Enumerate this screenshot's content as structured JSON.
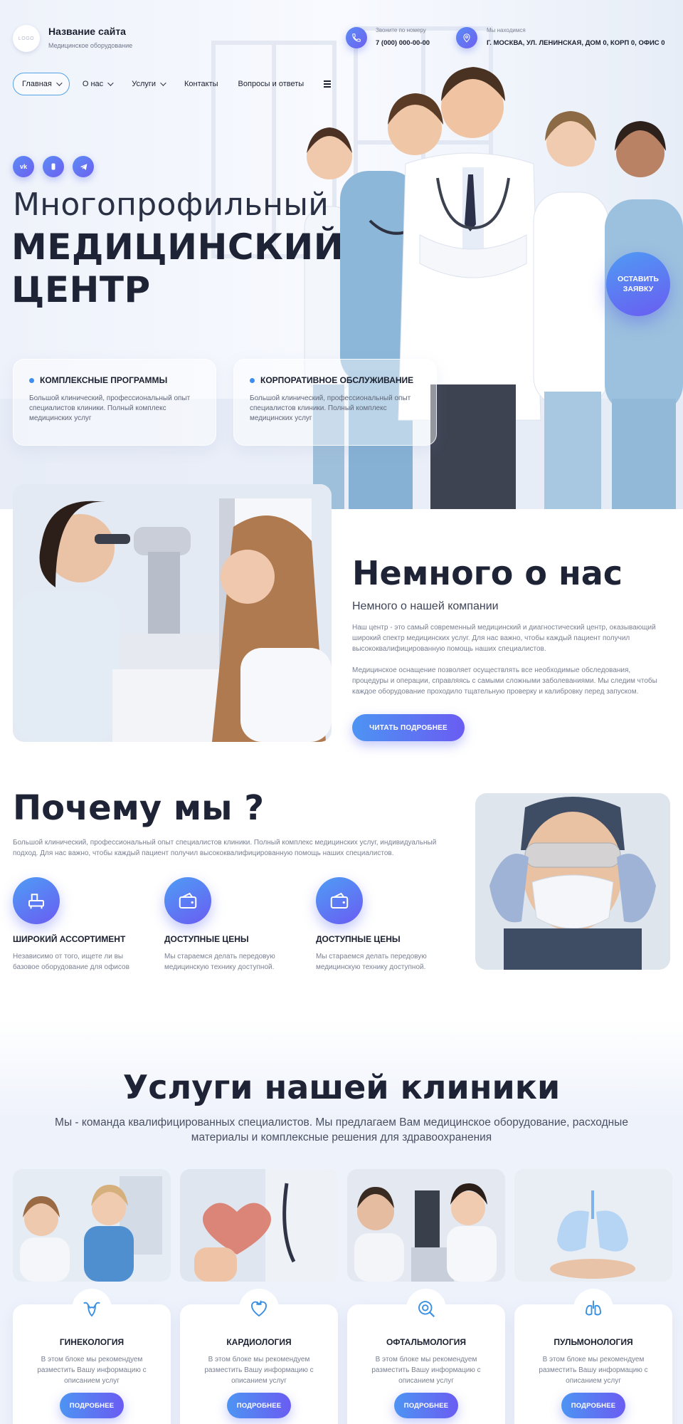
{
  "header": {
    "logo_text": "LOGO",
    "site_title": "Название сайта",
    "site_subtitle": "Медицинское оборудование",
    "phone_label": "Звоните по номеру",
    "phone_value": "7 (000) 000-00-00",
    "address_label": "Мы находимся",
    "address_value": "Г. МОСКВА, УЛ. ЛЕНИНСКАЯ, ДОМ 0, КОРП 0, ОФИС 0"
  },
  "nav": {
    "items": [
      {
        "label": "Главная",
        "has_dropdown": true,
        "active": true
      },
      {
        "label": "О нас",
        "has_dropdown": true
      },
      {
        "label": "Услуги",
        "has_dropdown": true
      },
      {
        "label": "Контакты",
        "has_dropdown": false
      },
      {
        "label": "Вопросы и ответы",
        "has_dropdown": false
      }
    ],
    "menu_icon": "hamburger-icon"
  },
  "social": [
    {
      "icon": "vk-icon",
      "text": "vk"
    },
    {
      "icon": "viber-icon",
      "text": ""
    },
    {
      "icon": "telegram-icon",
      "text": ""
    }
  ],
  "hero": {
    "line1": "Многопрофильный",
    "line2": "МЕДИЦИНСКИЙ",
    "line3": "ЦЕНТР",
    "cta": "ОСТАВИТЬ ЗАЯВКУ",
    "cards": [
      {
        "title": "КОМПЛЕКСНЫЕ ПРОГРАММЫ",
        "text": "Большой клинический, профессиональный опыт специалистов клиники. Полный комплекс медицинских услуг"
      },
      {
        "title": "КОРПОРАТИВНОЕ ОБСЛУЖИВАНИЕ",
        "text": "Большой клинический, профессиональный опыт специалистов клиники. Полный комплекс медицинских услуг"
      }
    ]
  },
  "about": {
    "title": "Немного о нас",
    "subtitle": "Немного о нашей компании",
    "p1": "Наш центр - это самый современный медицинский и диагностический центр, оказывающий широкий спектр медицинских услуг. Для нас важно, чтобы каждый пациент получил высококвалифицированную помощь наших специалистов.",
    "p2": "Медицинское оснащение позволяет осуществлять все необходимые обследования, процедуры и операции, справляясь с самыми сложными заболеваниями. Мы следим чтобы каждое оборудование проходило тщательную проверку и калибровку перед запуском.",
    "button": "ЧИТАТЬ ПОДРОБНЕЕ"
  },
  "why": {
    "title": "Почему мы ?",
    "text": "Большой клинический, профессиональный опыт специалистов клиники. Полный комплекс медицинских услуг, индивидуальный подход. Для нас важно, чтобы каждый пациент получил высококвалифицированную помощь наших специалистов.",
    "features": [
      {
        "icon": "equipment-icon",
        "title": "ШИРОКИЙ АССОРТИМЕНТ",
        "text": "Независимо от того, ищете ли вы базовое оборудование для офисов"
      },
      {
        "icon": "wallet-icon",
        "title": "ДОСТУПНЫЕ ЦЕНЫ",
        "text": "Мы стараемся делать передовую медицинскую технику доступной."
      },
      {
        "icon": "wallet-icon",
        "title": "ДОСТУПНЫЕ ЦЕНЫ",
        "text": "Мы стараемся делать передовую медицинскую технику доступной."
      }
    ]
  },
  "services": {
    "title": "Услуги нашей клиники",
    "subtitle": "Мы - команда квалифицированных специалистов. Мы предлагаем Вам медицинское оборудование, расходные материалы и комплексные решения для здравоохранения",
    "items": [
      {
        "icon": "uterus-icon",
        "name": "ГИНЕКОЛОГИЯ",
        "text": "В этом блоке мы рекомендуем разместить Вашу информацию с описанием услуг",
        "button": "ПОДРОБНЕЕ"
      },
      {
        "icon": "heart-icon",
        "name": "КАРДИОЛОГИЯ",
        "text": "В этом блоке мы рекомендуем разместить Вашу информацию с описанием услуг",
        "button": "ПОДРОБНЕЕ"
      },
      {
        "icon": "eye-icon",
        "name": "ОФТАЛЬМОЛОГИЯ",
        "text": "В этом блоке мы рекомендуем разместить Вашу информацию с описанием услуг",
        "button": "ПОДРОБНЕЕ"
      },
      {
        "icon": "lungs-icon",
        "name": "ПУЛЬМОНОЛОГИЯ",
        "text": "В этом блоке мы рекомендуем разместить Вашу информацию с описанием услуг",
        "button": "ПОДРОБНЕЕ"
      }
    ]
  },
  "colors": {
    "accent_start": "#4d94f3",
    "accent_end": "#6a5cf2",
    "heading": "#1f2336",
    "body_text": "#7a8092"
  }
}
